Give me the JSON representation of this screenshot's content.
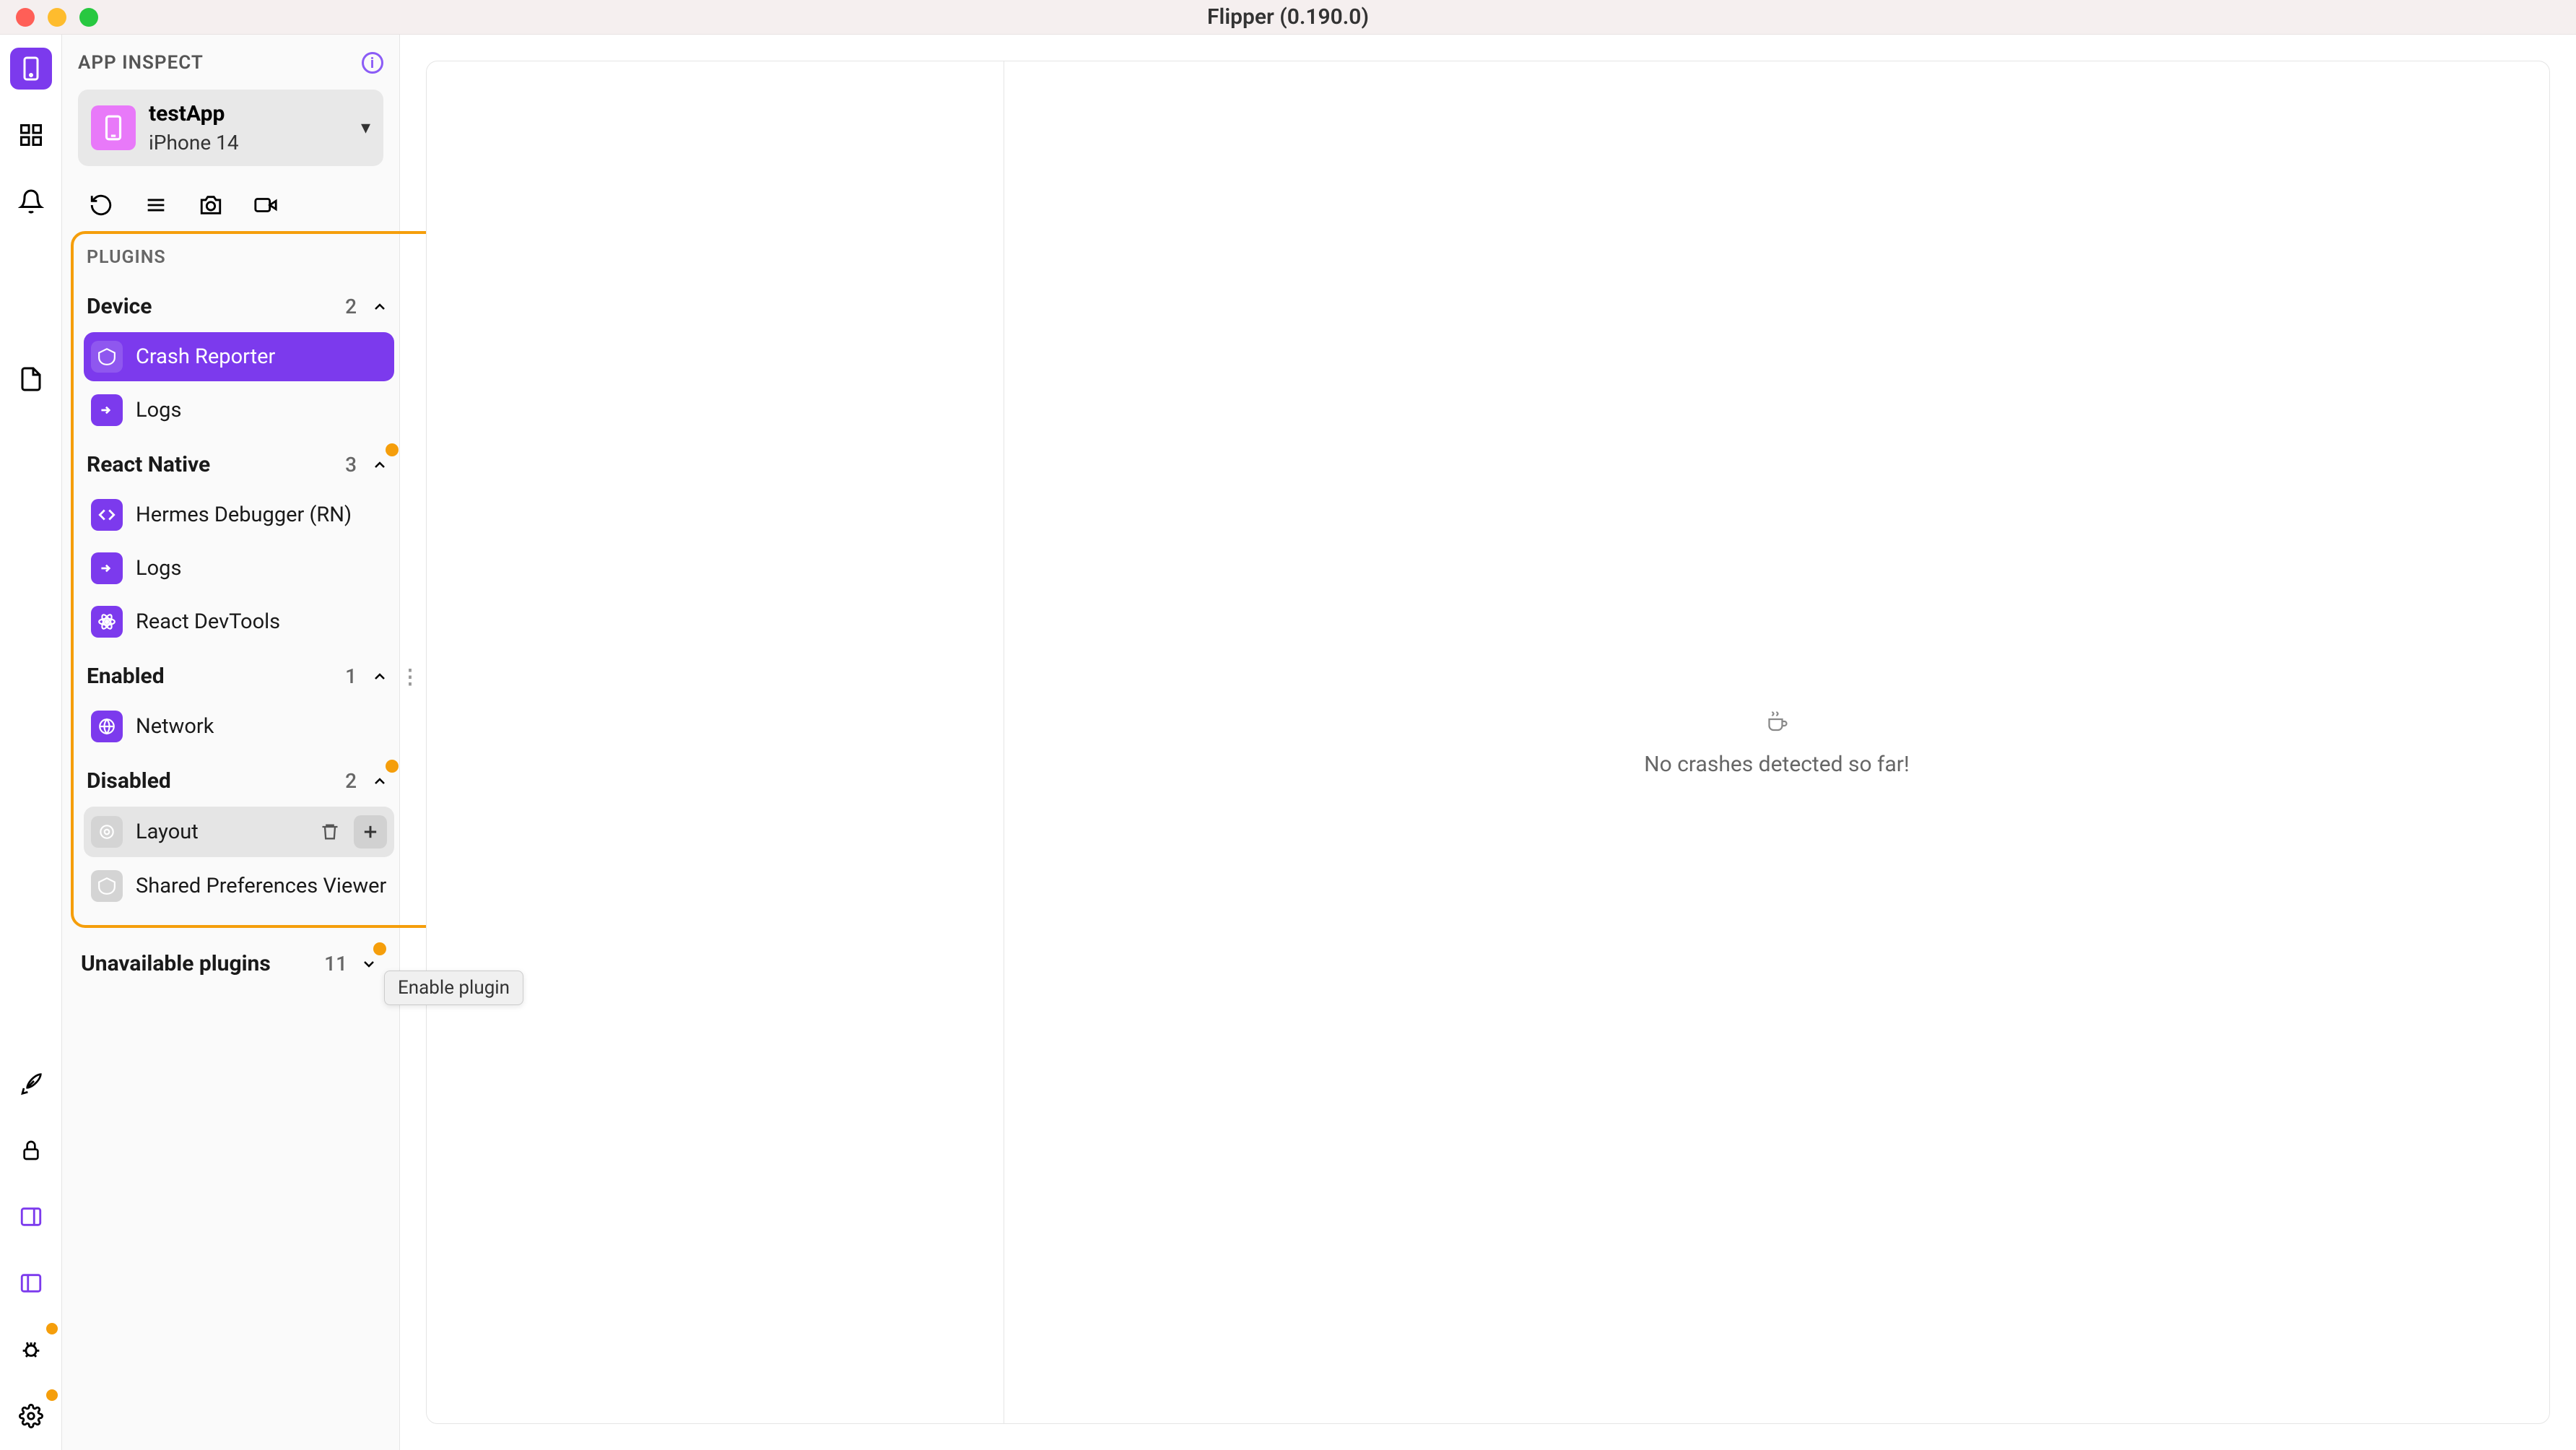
{
  "window": {
    "title": "Flipper (0.190.0)"
  },
  "inspector": {
    "header": "APP INSPECT",
    "device_selector": {
      "app": "testApp",
      "device": "iPhone 14"
    },
    "plugins_header": "PLUGINS",
    "groups": {
      "device": {
        "label": "Device",
        "count": "2",
        "items": [
          {
            "label": "Crash Reporter",
            "active": true
          },
          {
            "label": "Logs"
          }
        ]
      },
      "react_native": {
        "label": "React Native",
        "count": "3",
        "has_attention": true,
        "items": [
          {
            "label": "Hermes Debugger (RN)"
          },
          {
            "label": "Logs"
          },
          {
            "label": "React DevTools"
          }
        ]
      },
      "enabled": {
        "label": "Enabled",
        "count": "1",
        "items": [
          {
            "label": "Network"
          }
        ]
      },
      "disabled": {
        "label": "Disabled",
        "count": "2",
        "has_attention": true,
        "items": [
          {
            "label": "Layout",
            "hovered": true
          },
          {
            "label": "Shared Preferences Viewer"
          }
        ]
      }
    },
    "unavailable": {
      "label": "Unavailable plugins",
      "count": "11"
    },
    "tooltip": "Enable plugin"
  },
  "content": {
    "empty_message": "No crashes detected so far!"
  }
}
